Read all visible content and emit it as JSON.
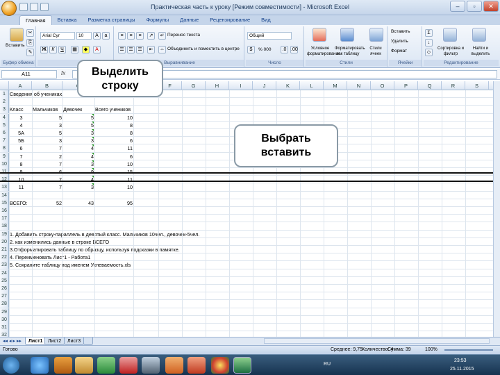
{
  "window": {
    "title": "Практическая часть к уроку  [Режим совместимости] - Microsoft Excel"
  },
  "ribbon": {
    "tabs": [
      "Главная",
      "Вставка",
      "Разметка страницы",
      "Формулы",
      "Данные",
      "Рецензирование",
      "Вид"
    ],
    "active_tab": "Главная",
    "groups": [
      "Буфер обмена",
      "Шрифт",
      "Выравнивание",
      "Число",
      "Стили",
      "Ячейки",
      "Редактирование"
    ],
    "paste_label": "Вставить",
    "font_name": "Arial Cyr",
    "font_size": "10",
    "wrap_text": "Перенос текста",
    "merge_center": "Объединить и поместить в центре",
    "number_format": "Общий",
    "percent_label": "% 000",
    "cond_format": "Условное форматирование",
    "format_table": "Форматировать как таблицу",
    "cell_styles": "Стили ячеек",
    "insert_label": "Вставить",
    "delete_label": "Удалить",
    "format_label": "Формат",
    "sort_filter": "Сортировка и фильтр",
    "find_select": "Найти и выделить"
  },
  "formula_bar": {
    "name_box": "A11",
    "fx": "fx",
    "value": ""
  },
  "columns": [
    "A",
    "B",
    "C",
    "D",
    "E",
    "F",
    "G",
    "H",
    "I",
    "J",
    "K",
    "L",
    "M",
    "N",
    "O",
    "P",
    "Q",
    "R",
    "S"
  ],
  "rows": [
    {
      "n": "1",
      "a": "Сведения об учениках.",
      "b": "",
      "c": "",
      "d": ""
    },
    {
      "n": "2",
      "a": "",
      "b": "",
      "c": "",
      "d": ""
    },
    {
      "n": "3",
      "a": "Класс",
      "b": "Мальчиков",
      "c": "Девочек",
      "d": "Всего учеников"
    },
    {
      "n": "4",
      "a": "3",
      "b": "5",
      "c": "5",
      "d": "10"
    },
    {
      "n": "5",
      "a": "4",
      "b": "3",
      "c": "5",
      "d": "8"
    },
    {
      "n": "6",
      "a": "5А",
      "b": "5",
      "c": "3",
      "d": "8"
    },
    {
      "n": "7",
      "a": "5Б",
      "b": "3",
      "c": "3",
      "d": "6"
    },
    {
      "n": "8",
      "a": "6",
      "b": "7",
      "c": "4",
      "d": "11"
    },
    {
      "n": "9",
      "a": "7",
      "b": "2",
      "c": "4",
      "d": "6"
    },
    {
      "n": "10",
      "a": "8",
      "b": "7",
      "c": "3",
      "d": "10"
    },
    {
      "n": "11",
      "a": "9",
      "b": "6",
      "c": "9",
      "d": "15"
    },
    {
      "n": "12",
      "a": "10",
      "b": "7",
      "c": "4",
      "d": "11"
    },
    {
      "n": "13",
      "a": "11",
      "b": "7",
      "c": "3",
      "d": "10"
    },
    {
      "n": "14",
      "a": "",
      "b": "",
      "c": "",
      "d": ""
    },
    {
      "n": "15",
      "a": "ВСЕГО:",
      "b": "52",
      "c": "43",
      "d": "95"
    },
    {
      "n": "16",
      "a": "",
      "b": "",
      "c": "",
      "d": ""
    },
    {
      "n": "17",
      "a": "",
      "b": "",
      "c": "",
      "d": ""
    },
    {
      "n": "18",
      "a": "",
      "b": "",
      "c": "",
      "d": ""
    },
    {
      "n": "19",
      "a": "1. Добавить строку-параллель в девятый  класс. Мальчиков 10чел., девочек-5чел.",
      "b": "",
      "c": "",
      "d": ""
    },
    {
      "n": "20",
      "a": "2. как изменились данные в строке ВСЕГО",
      "b": "",
      "c": "",
      "d": ""
    },
    {
      "n": "21",
      "a": "3.Отформатировать таблицу по образцу, используя подсказки в памятке.",
      "b": "",
      "c": "",
      "d": ""
    },
    {
      "n": "22",
      "a": "4. Переименовать Лист1 -  Работа1",
      "b": "",
      "c": "",
      "d": ""
    },
    {
      "n": "23",
      "a": "5.  Сохраните таблицу под именем Успеваемость.xls",
      "b": "",
      "c": "",
      "d": ""
    },
    {
      "n": "24",
      "a": "",
      "b": "",
      "c": "",
      "d": ""
    },
    {
      "n": "25",
      "a": "",
      "b": "",
      "c": "",
      "d": ""
    },
    {
      "n": "26",
      "a": "",
      "b": "",
      "c": "",
      "d": ""
    },
    {
      "n": "27",
      "a": "",
      "b": "",
      "c": "",
      "d": ""
    },
    {
      "n": "28",
      "a": "",
      "b": "",
      "c": "",
      "d": ""
    },
    {
      "n": "29",
      "a": "",
      "b": "",
      "c": "",
      "d": ""
    },
    {
      "n": "30",
      "a": "",
      "b": "",
      "c": "",
      "d": ""
    },
    {
      "n": "31",
      "a": "",
      "b": "",
      "c": "",
      "d": ""
    },
    {
      "n": "32",
      "a": "",
      "b": "",
      "c": "",
      "d": ""
    }
  ],
  "sheets": [
    "Лист1",
    "Лист2",
    "Лист3"
  ],
  "active_sheet": "Лист1",
  "status": {
    "ready": "Готово",
    "average": "Среднее: 9,75",
    "count": "Количество: 4",
    "sum": "Сумма: 39",
    "zoom": "100%"
  },
  "taskbar": {
    "lang": "RU",
    "time": "23:53",
    "date": "25.11.2015"
  },
  "callouts": {
    "select_row": "Выделить строку",
    "choose_insert": "Выбрать вставить"
  },
  "colors": {
    "accent": "#15428b",
    "callout_border": "#8a9aa6",
    "excel_green": "#1d6f42"
  }
}
